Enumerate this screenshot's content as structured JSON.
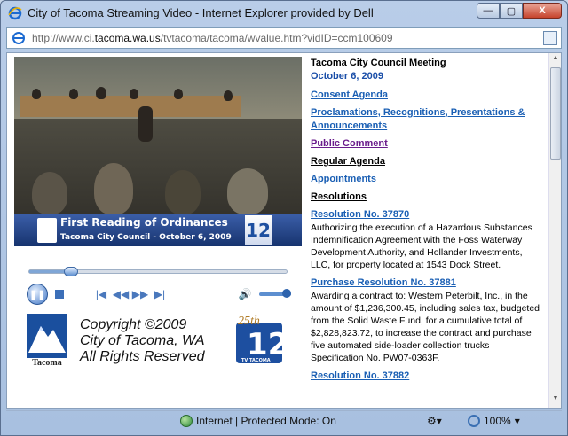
{
  "window": {
    "title": "City of Tacoma Streaming Video - Internet Explorer provided by Dell",
    "minimize": "—",
    "maximize": "▢",
    "close": "X"
  },
  "address": {
    "prefix": "http://www.ci.",
    "domain": "tacoma.wa.us",
    "path": "/tvtacoma/tacoma/wvalue.htm?vidID=ccm100609"
  },
  "video": {
    "lower_third_title": "First Reading of Ordinances",
    "lower_third_sub": "Tacoma City Council - October 6, 2009",
    "channel_badge": "12",
    "progress": 0.16
  },
  "player": {
    "play_icon": "pause-icon",
    "volume_level": 0.85
  },
  "copyright": {
    "line1": "Copyright ©2009",
    "line2": "City of Tacoma, WA",
    "line3": "All Rights Reserved",
    "logo_word": "Tacoma",
    "ch12_anniv": "25th",
    "ch12_number": "12",
    "ch12_name": "TV TACOMA"
  },
  "agenda": {
    "meeting_title": "Tacoma City Council Meeting",
    "meeting_date": "October 6, 2009",
    "links": [
      {
        "label": "Consent Agenda"
      },
      {
        "label": "Proclamations, Recognitions, Presentations & Announcements"
      },
      {
        "label": "Public Comment"
      }
    ],
    "regular_agenda": "Regular Agenda",
    "appointments": "Appointments",
    "resolutions": "Resolutions",
    "items": [
      {
        "label": "Resolution No. 37870",
        "desc": "Authorizing the execution of a Hazardous Substances Indemnification Agreement with the Foss Waterway Development Authority, and Hollander Investments, LLC, for property located at 1543 Dock Street."
      },
      {
        "label": "Purchase Resolution No. 37881",
        "desc": "Awarding a contract to: Western Peterbilt, Inc., in the amount of $1,236,300.45, including sales tax, budgeted from the Solid Waste Fund, for a cumulative total of $2,828,823.72, to increase the contract and purchase five automated side-loader collection trucks  Specification No. PW07-0363F."
      },
      {
        "label": "Resolution No. 37882",
        "desc": ""
      }
    ]
  },
  "status": {
    "zone": "Internet | Protected Mode: On",
    "zoom": "100%"
  }
}
